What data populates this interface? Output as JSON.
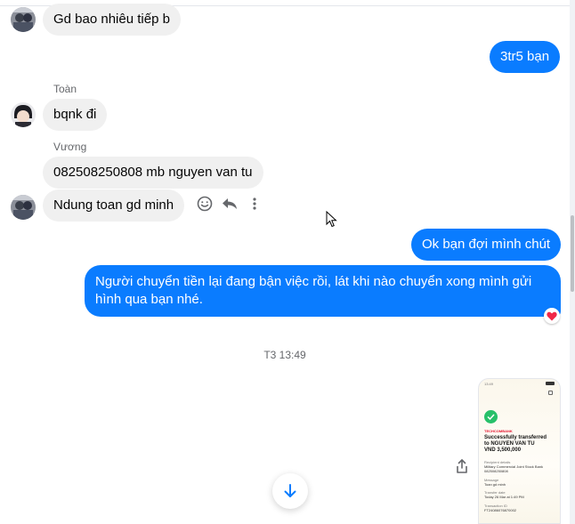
{
  "messages": {
    "m1": {
      "text": "Gd bao nhiêu tiếp b"
    },
    "m2": {
      "text": "3tr5 bạn"
    },
    "m3": {
      "sender": "Toàn",
      "text": "bqnk đi"
    },
    "m4": {
      "sender": "Vương",
      "text": "082508250808 mb nguyen van tu"
    },
    "m5": {
      "text": "Ndung toan gd minh"
    },
    "m6": {
      "text": "Ok bạn đợi mình chút"
    },
    "m7": {
      "line1": "Người chuyển tiền lại đang bận việc rồi, lát khi nào chuyển xong mình gửi",
      "line2": "hình qua bạn nhé."
    },
    "timestamp": "T3 13:49"
  },
  "receipt_image": {
    "status_time": "13:49",
    "bank_brand": "TECHCOMBANK",
    "title_line1": "Successfully transferred",
    "title_line2": "to NGUYEN VAN TU",
    "amount": "VND 3,500,000",
    "recipient_label": "Recipient details",
    "recipient_bank": "Military Commercial Joint Stock Bank",
    "recipient_account": "082508250808",
    "message_label": "Message",
    "message_value": "Toan gd minh",
    "date_label": "Transfer date",
    "date_value": "Today 26 Mar at 1:49 PM",
    "txn_label": "Transaction ID",
    "txn_value": "FT24086076870002"
  },
  "colors": {
    "outgoing_bubble": "#0a7cff",
    "incoming_bubble": "#f0f0f0",
    "reaction": "#f02849"
  },
  "icons": {
    "react": "smiley-icon",
    "reply": "reply-icon",
    "more": "more-vertical-icon",
    "share": "share-icon",
    "scroll_down": "arrow-down-icon",
    "reaction": "heart-icon"
  }
}
